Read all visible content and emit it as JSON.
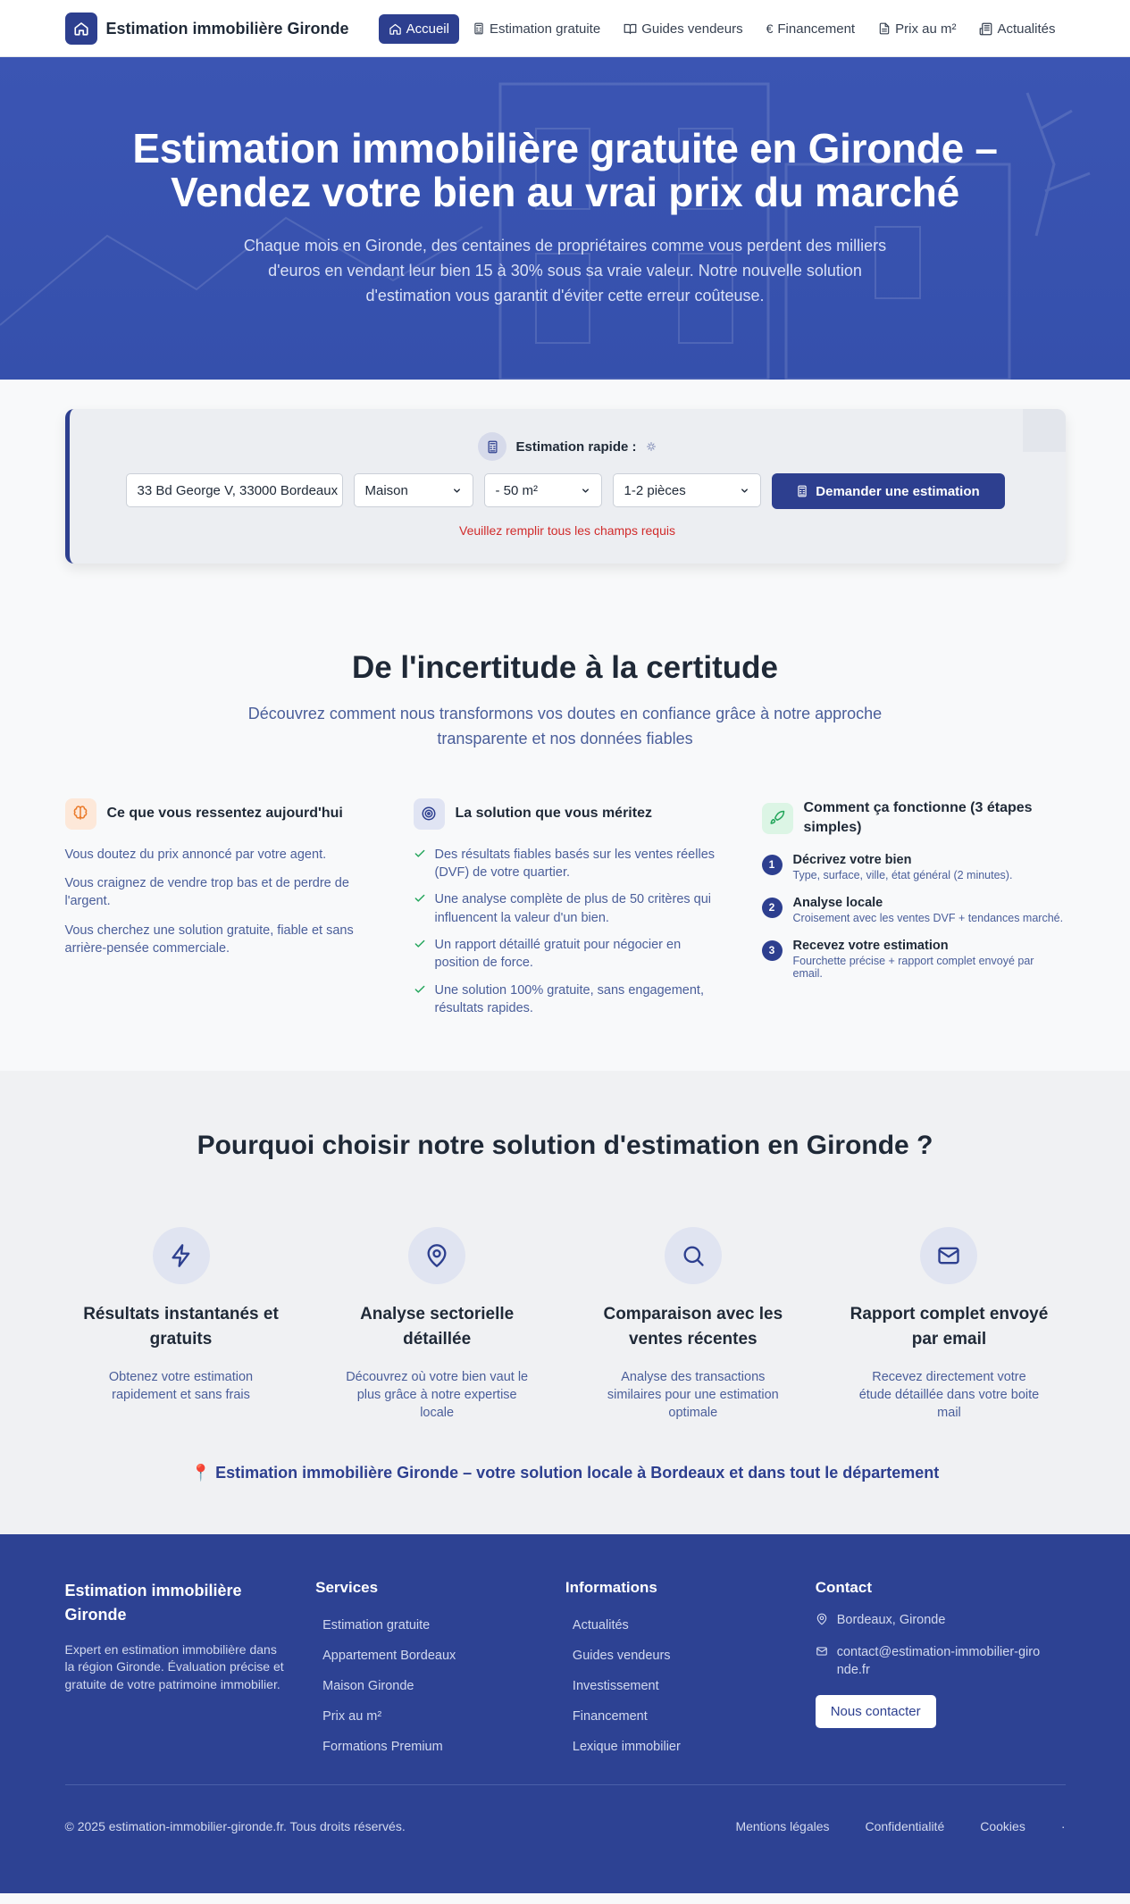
{
  "nav": {
    "brand": "Estimation immobilière Gironde",
    "items": [
      {
        "label": "Accueil"
      },
      {
        "label": "Estimation gratuite"
      },
      {
        "label": "Guides vendeurs"
      },
      {
        "label": "Financement"
      },
      {
        "label": "Prix au m²"
      },
      {
        "label": "Actualités"
      }
    ]
  },
  "hero": {
    "title": "Estimation immobilière gratuite en Gironde – Vendez votre bien au vrai prix du marché",
    "subtitle": "Chaque mois en Gironde, des centaines de propriétaires comme vous perdent des milliers d'euros en vendant leur bien 15 à 30% sous sa vraie valeur. Notre nouvelle solution d'estimation vous garantit d'éviter cette erreur coûteuse."
  },
  "estimate": {
    "title": "Estimation rapide :",
    "address": "33 Bd George V, 33000 Bordeaux",
    "property_type": "Maison",
    "surface": "- 50 m²",
    "rooms": "1-2 pièces",
    "button": "Demander une estimation",
    "error": "Veuillez remplir tous les champs requis"
  },
  "certainty": {
    "title": "De l'incertitude à la certitude",
    "subtitle": "Découvrez comment nous transformons vos doutes en confiance grâce à notre approche transparente et nos données fiables",
    "feel": {
      "title": "Ce que vous ressentez aujourd'hui",
      "items": [
        "Vous doutez du prix annoncé par votre agent.",
        "Vous craignez de vendre trop bas et de perdre de l'argent.",
        "Vous cherchez une solution gratuite, fiable et sans arrière-pensée commerciale."
      ]
    },
    "solution": {
      "title": "La solution que vous méritez",
      "items": [
        "Des résultats fiables basés sur les ventes réelles (DVF) de votre quartier.",
        "Une analyse complète de plus de 50 critères qui influencent la valeur d'un bien.",
        "Un rapport détaillé gratuit pour négocier en position de force.",
        "Une solution 100% gratuite, sans engagement, résultats rapides."
      ]
    },
    "steps": {
      "title": "Comment ça fonctionne (3 étapes simples)",
      "items": [
        {
          "num": "1",
          "title": "Décrivez votre bien",
          "desc": "Type, surface, ville, état général (2 minutes)."
        },
        {
          "num": "2",
          "title": "Analyse locale",
          "desc": "Croisement avec les ventes DVF + tendances marché."
        },
        {
          "num": "3",
          "title": "Recevez votre estimation",
          "desc": "Fourchette précise + rapport complet envoyé par email."
        }
      ]
    }
  },
  "why": {
    "title": "Pourquoi choisir notre solution d'estimation en Gironde ?",
    "features": [
      {
        "icon": "lightning-icon",
        "title": "Résultats instantanés et gratuits",
        "desc": "Obtenez votre estimation rapidement et sans frais"
      },
      {
        "icon": "map-pin-icon",
        "title": "Analyse sectorielle détaillée",
        "desc": "Découvrez où votre bien vaut le plus grâce à notre expertise locale"
      },
      {
        "icon": "search-icon",
        "title": "Comparaison avec les ventes récentes",
        "desc": "Analyse des transactions similaires pour une estimation optimale"
      },
      {
        "icon": "mail-icon",
        "title": "Rapport complet envoyé par email",
        "desc": "Recevez directement votre étude détaillée dans votre boite mail"
      }
    ],
    "local": "📍 Estimation immobilière Gironde – votre solution locale à Bordeaux et dans tout le département"
  },
  "footer": {
    "brand": "Estimation immobilière Gironde",
    "desc": "Expert en estimation immobilière dans la région Gironde. Évaluation précise et gratuite de votre patrimoine immobilier.",
    "services_title": "Services",
    "services": [
      "Estimation gratuite",
      "Appartement Bordeaux",
      "Maison Gironde",
      "Prix au m²",
      "Formations Premium"
    ],
    "info_title": "Informations",
    "info": [
      "Actualités",
      "Guides vendeurs",
      "Investissement",
      "Financement",
      "Lexique immobilier"
    ],
    "contact_title": "Contact",
    "location": "Bordeaux, Gironde",
    "email": "contact@estimation-immobilier-gironde.fr",
    "contact_button": "Nous contacter",
    "copyright": "© 2025 estimation-immobilier-gironde.fr. Tous droits réservés.",
    "legal": [
      "Mentions légales",
      "Confidentialité",
      "Cookies"
    ],
    "dot": "·"
  }
}
